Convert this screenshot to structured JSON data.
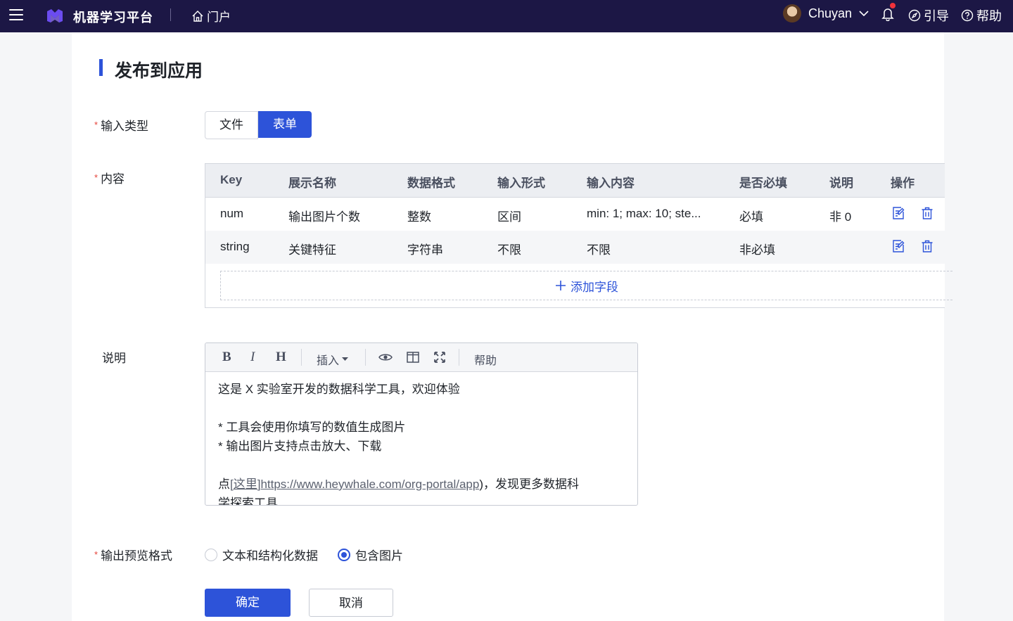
{
  "header": {
    "brand": "机器学习平台",
    "portal_label": "门户",
    "username": "Chuyan",
    "guide_label": "引导",
    "help_label": "帮助"
  },
  "page": {
    "title": "发布到应用"
  },
  "form": {
    "input_type_label": "输入类型",
    "input_type_options": [
      "文件",
      "表单"
    ],
    "input_type_selected": "表单",
    "content_label": "内容",
    "table": {
      "columns": [
        "Key",
        "展示名称",
        "数据格式",
        "输入形式",
        "输入内容",
        "是否必填",
        "说明",
        "操作"
      ],
      "rows": [
        {
          "key": "num",
          "display_name": "输出图片个数",
          "format": "整数",
          "input_form": "区间",
          "input_content": "min: 1; max: 10; ste...",
          "required": "必填",
          "desc": "非 0"
        },
        {
          "key": "string",
          "display_name": "关键特征",
          "format": "字符串",
          "input_form": "不限",
          "input_content": "不限",
          "required": "非必填",
          "desc": ""
        }
      ],
      "add_field_label": "添加字段"
    },
    "desc_label": "说明",
    "editor": {
      "toolbar": {
        "bold": "B",
        "italic": "I",
        "heading": "H",
        "insert": "插入",
        "help": "帮助"
      },
      "line1": "这是 X 实验室开发的数据科学工具，欢迎体验",
      "line3": "* 工具会使用你填写的数值生成图片",
      "line4": "* 输出图片支持点击放大、下载",
      "line6_prefix": "点",
      "line6_link_text": "[这里]",
      "line6_link_url": "https://www.heywhale.com/org-portal/app",
      "line6_suffix": ")，发现更多数据科",
      "line7": "学探索工具"
    },
    "output_label": "输出预览格式",
    "output_options": [
      "文本和结构化数据",
      "包含图片"
    ],
    "output_selected": "包含图片",
    "confirm_label": "确定",
    "cancel_label": "取消"
  },
  "colors": {
    "topbar": "#1c1745",
    "primary": "#2d53d9",
    "required": "#e5443b"
  }
}
